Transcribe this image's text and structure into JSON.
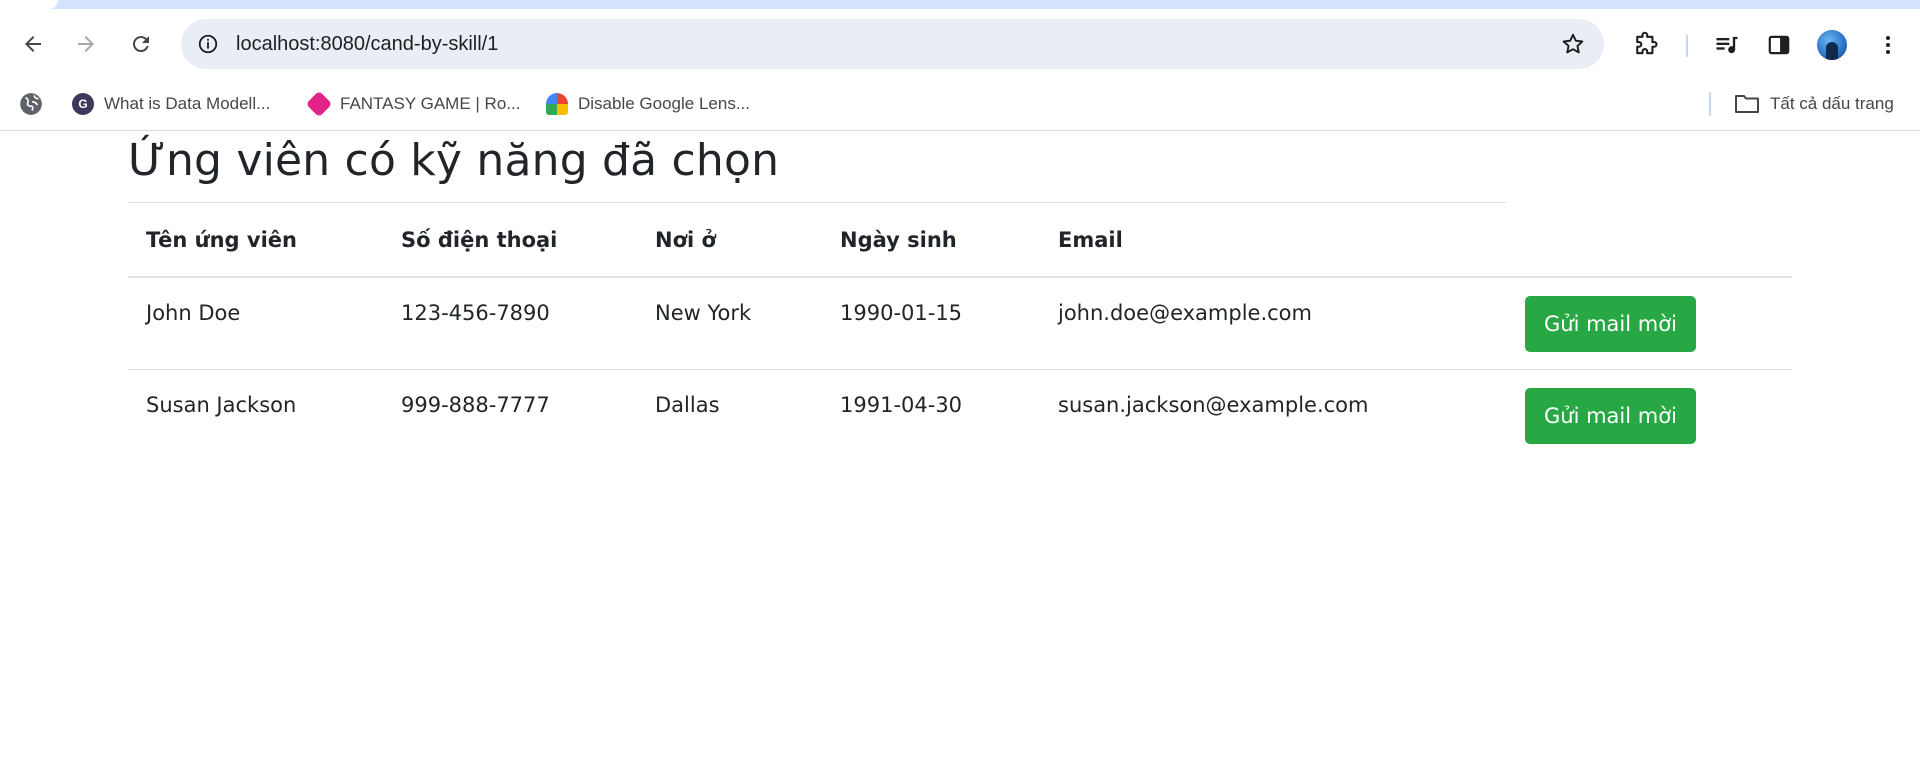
{
  "browser": {
    "url": "localhost:8080/cand-by-skill/1",
    "bookmarks": [
      {
        "label": "What is Data Modell...",
        "icon": "data-modelling-favicon-icon"
      },
      {
        "label": "FANTASY GAME | Ro...",
        "icon": "fantasy-game-favicon-icon"
      },
      {
        "label": "Disable Google Lens...",
        "icon": "google-lens-favicon-icon"
      }
    ],
    "all_bookmarks_label": "Tất cả dấu trang"
  },
  "page": {
    "title": "Ứng viên có kỹ năng đã chọn",
    "table": {
      "headers": [
        "Tên ứng viên",
        "Số điện thoại",
        "Nơi ở",
        "Ngày sinh",
        "Email"
      ],
      "rows": [
        {
          "name": "John Doe",
          "phone": "123-456-7890",
          "location": "New York",
          "dob": "1990-01-15",
          "email": "john.doe@example.com",
          "action": "Gửi mail mời"
        },
        {
          "name": "Susan Jackson",
          "phone": "999-888-7777",
          "location": "Dallas",
          "dob": "1991-04-30",
          "email": "susan.jackson@example.com",
          "action": "Gửi mail mời"
        }
      ]
    }
  },
  "colors": {
    "invite_button": "#28a745",
    "text": "#212529",
    "omnibox": "#e9eef6",
    "tabstrip": "#d3e3fd"
  }
}
